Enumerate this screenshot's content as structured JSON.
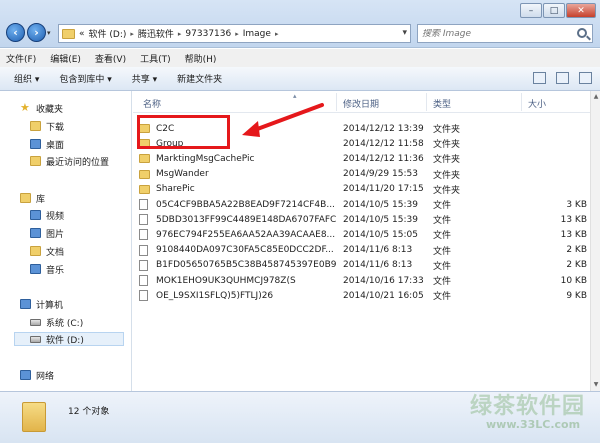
{
  "address": {
    "back_symbol": "«",
    "parts": [
      "软件 (D:)",
      "腾迅软件",
      "97337136",
      "Image"
    ],
    "dropdown_symbol": "▾"
  },
  "search": {
    "placeholder": "搜索 Image"
  },
  "window_buttons": {
    "minimize": "–",
    "maximize": "□",
    "close": "✕"
  },
  "menu": [
    "文件(F)",
    "编辑(E)",
    "查看(V)",
    "工具(T)",
    "帮助(H)"
  ],
  "toolbar": [
    "组织 ▾",
    "包含到库中 ▾",
    "共享 ▾",
    "新建文件夹"
  ],
  "sidebar": {
    "favorites": "收藏夹",
    "fav_items": [
      "下载",
      "桌面",
      "最近访问的位置"
    ],
    "libraries": "库",
    "lib_items": [
      "视频",
      "图片",
      "文档",
      "音乐"
    ],
    "computer": "计算机",
    "drives": [
      "系统 (C:)",
      "软件 (D:)"
    ],
    "network": "网络"
  },
  "columns": {
    "name": "名称",
    "date": "修改日期",
    "type": "类型",
    "size": "大小"
  },
  "files": [
    {
      "name": "C2C",
      "date": "2014/12/12 13:39",
      "type": "文件夹",
      "size": "",
      "kind": "folder"
    },
    {
      "name": "Group",
      "date": "2014/12/12 11:58",
      "type": "文件夹",
      "size": "",
      "kind": "folder"
    },
    {
      "name": "MarktingMsgCachePic",
      "date": "2014/12/12 11:36",
      "type": "文件夹",
      "size": "",
      "kind": "folder"
    },
    {
      "name": "MsgWander",
      "date": "2014/9/29 15:53",
      "type": "文件夹",
      "size": "",
      "kind": "folder"
    },
    {
      "name": "SharePic",
      "date": "2014/11/20 17:15",
      "type": "文件夹",
      "size": "",
      "kind": "folder"
    },
    {
      "name": "05C4CF9BBA5A22B8EAD9F7214CF4B...",
      "date": "2014/10/5 15:39",
      "type": "文件",
      "size": "3 KB",
      "kind": "file"
    },
    {
      "name": "5DBD3013FF99C4489E148DA6707FAFC",
      "date": "2014/10/5 15:39",
      "type": "文件",
      "size": "13 KB",
      "kind": "file"
    },
    {
      "name": "976EC794F255EA6AA52AA39ACAAE8...",
      "date": "2014/10/5 15:05",
      "type": "文件",
      "size": "13 KB",
      "kind": "file"
    },
    {
      "name": "9108440DA097C30FA5C85E0DCC2DF...",
      "date": "2014/11/6 8:13",
      "type": "文件",
      "size": "2 KB",
      "kind": "file"
    },
    {
      "name": "B1FD05650765B5C38B458745397E0B9",
      "date": "2014/11/6 8:13",
      "type": "文件",
      "size": "2 KB",
      "kind": "file"
    },
    {
      "name": "MOK1EHO9UK3QUHMCJ978Z(S",
      "date": "2014/10/16 17:33",
      "type": "文件",
      "size": "10 KB",
      "kind": "file"
    },
    {
      "name": "OE_L9SXI1SFLQ)5)FTLJ)26",
      "date": "2014/10/21 16:05",
      "type": "文件",
      "size": "9 KB",
      "kind": "file"
    }
  ],
  "status": {
    "count": "12 个对象"
  },
  "watermark": {
    "text": "绿茶软件园",
    "url": "www.33LC.com"
  },
  "colors": {
    "highlight": "#e5181b",
    "accent": "#1f5fb1"
  }
}
